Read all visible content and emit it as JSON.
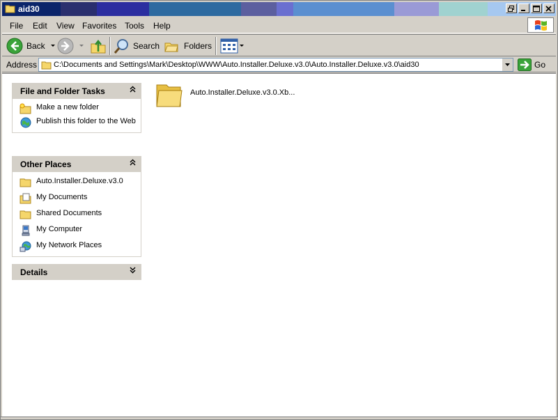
{
  "window": {
    "title": "aid30",
    "buttons": {
      "minimize": "minimize-icon",
      "maximize": "maximize-icon",
      "close": "close-icon",
      "restore": "restore-icon"
    }
  },
  "menu": {
    "items": [
      "File",
      "Edit",
      "View",
      "Favorites",
      "Tools",
      "Help"
    ]
  },
  "toolbar": {
    "back_label": "Back",
    "search_label": "Search",
    "folders_label": "Folders"
  },
  "address": {
    "label": "Address",
    "value": "C:\\Documents and Settings\\Mark\\Desktop\\WWW\\Auto.Installer.Deluxe.v3.0\\Auto.Installer.Deluxe.v3.0\\aid30",
    "go_label": "Go"
  },
  "tasks_panel": {
    "title": "File and Folder Tasks",
    "items": [
      {
        "label": "Make a new folder",
        "icon": "new-folder-icon"
      },
      {
        "label": "Publish this folder to the Web",
        "icon": "publish-web-icon"
      }
    ]
  },
  "places_panel": {
    "title": "Other Places",
    "items": [
      {
        "label": "Auto.Installer.Deluxe.v3.0",
        "icon": "folder-icon"
      },
      {
        "label": "My Documents",
        "icon": "my-documents-icon"
      },
      {
        "label": "Shared Documents",
        "icon": "folder-icon"
      },
      {
        "label": "My Computer",
        "icon": "my-computer-icon"
      },
      {
        "label": "My Network Places",
        "icon": "network-places-icon"
      }
    ]
  },
  "details_panel": {
    "title": "Details"
  },
  "files": [
    {
      "name": "Auto.Installer.Deluxe.v3.0.Xb...",
      "icon": "folder-icon"
    }
  ],
  "colors": {
    "face": "#d4d0c8",
    "folder": "#f5d66b"
  }
}
